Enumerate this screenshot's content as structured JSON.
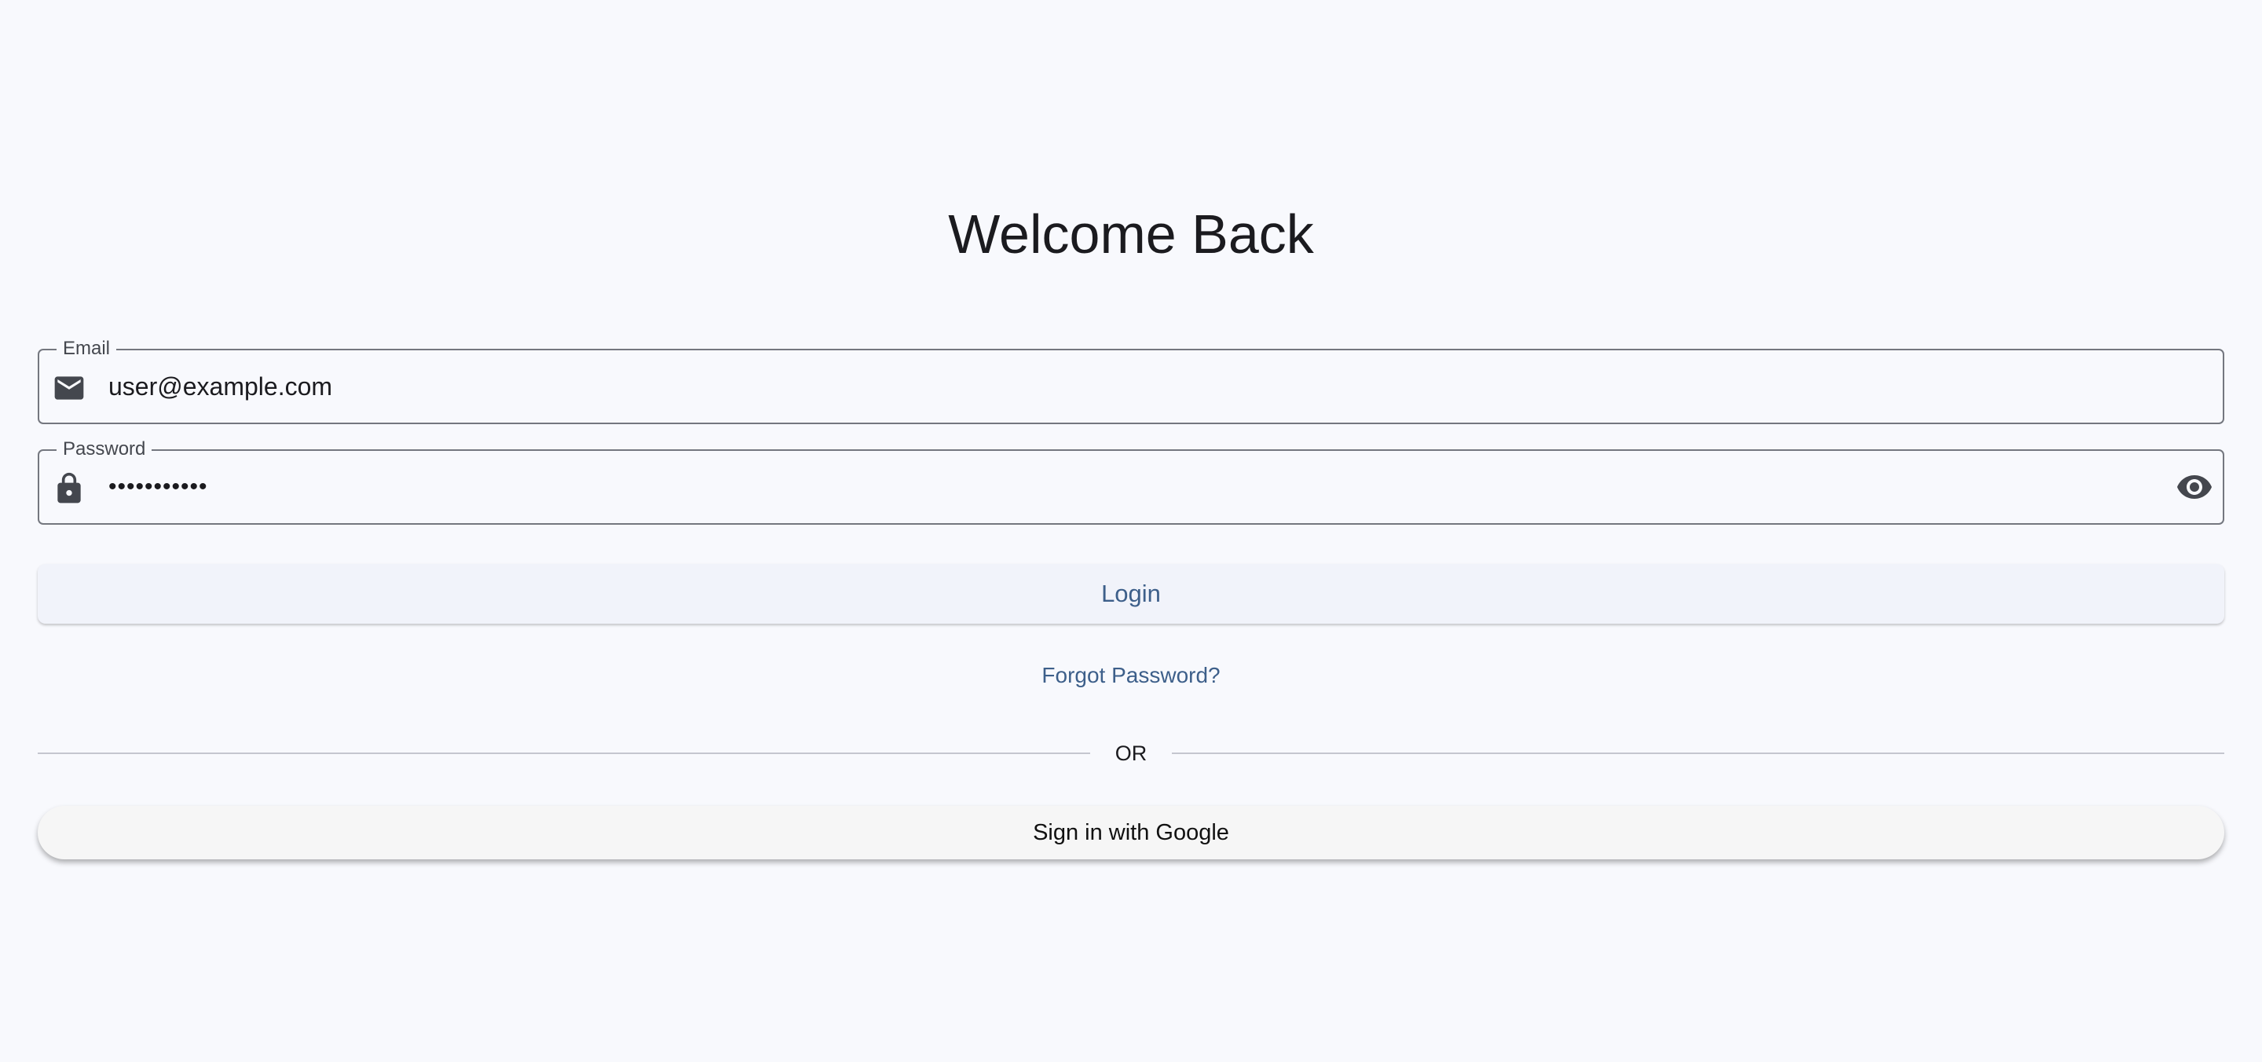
{
  "page": {
    "title": "Welcome Back"
  },
  "email": {
    "label": "Email",
    "value": "user@example.com",
    "icon": "mail-icon"
  },
  "password": {
    "label": "Password",
    "value": "•••••••••••",
    "icon": "lock-icon",
    "toggle_icon": "eye-icon"
  },
  "actions": {
    "login_label": "Login",
    "forgot_label": "Forgot Password?",
    "divider_label": "OR",
    "google_label": "Sign in with Google"
  },
  "colors": {
    "background": "#f8f9fd",
    "primary": "#3d5f8a",
    "text": "#1b1b1f",
    "outline": "#74777f",
    "icon": "#44474e"
  }
}
